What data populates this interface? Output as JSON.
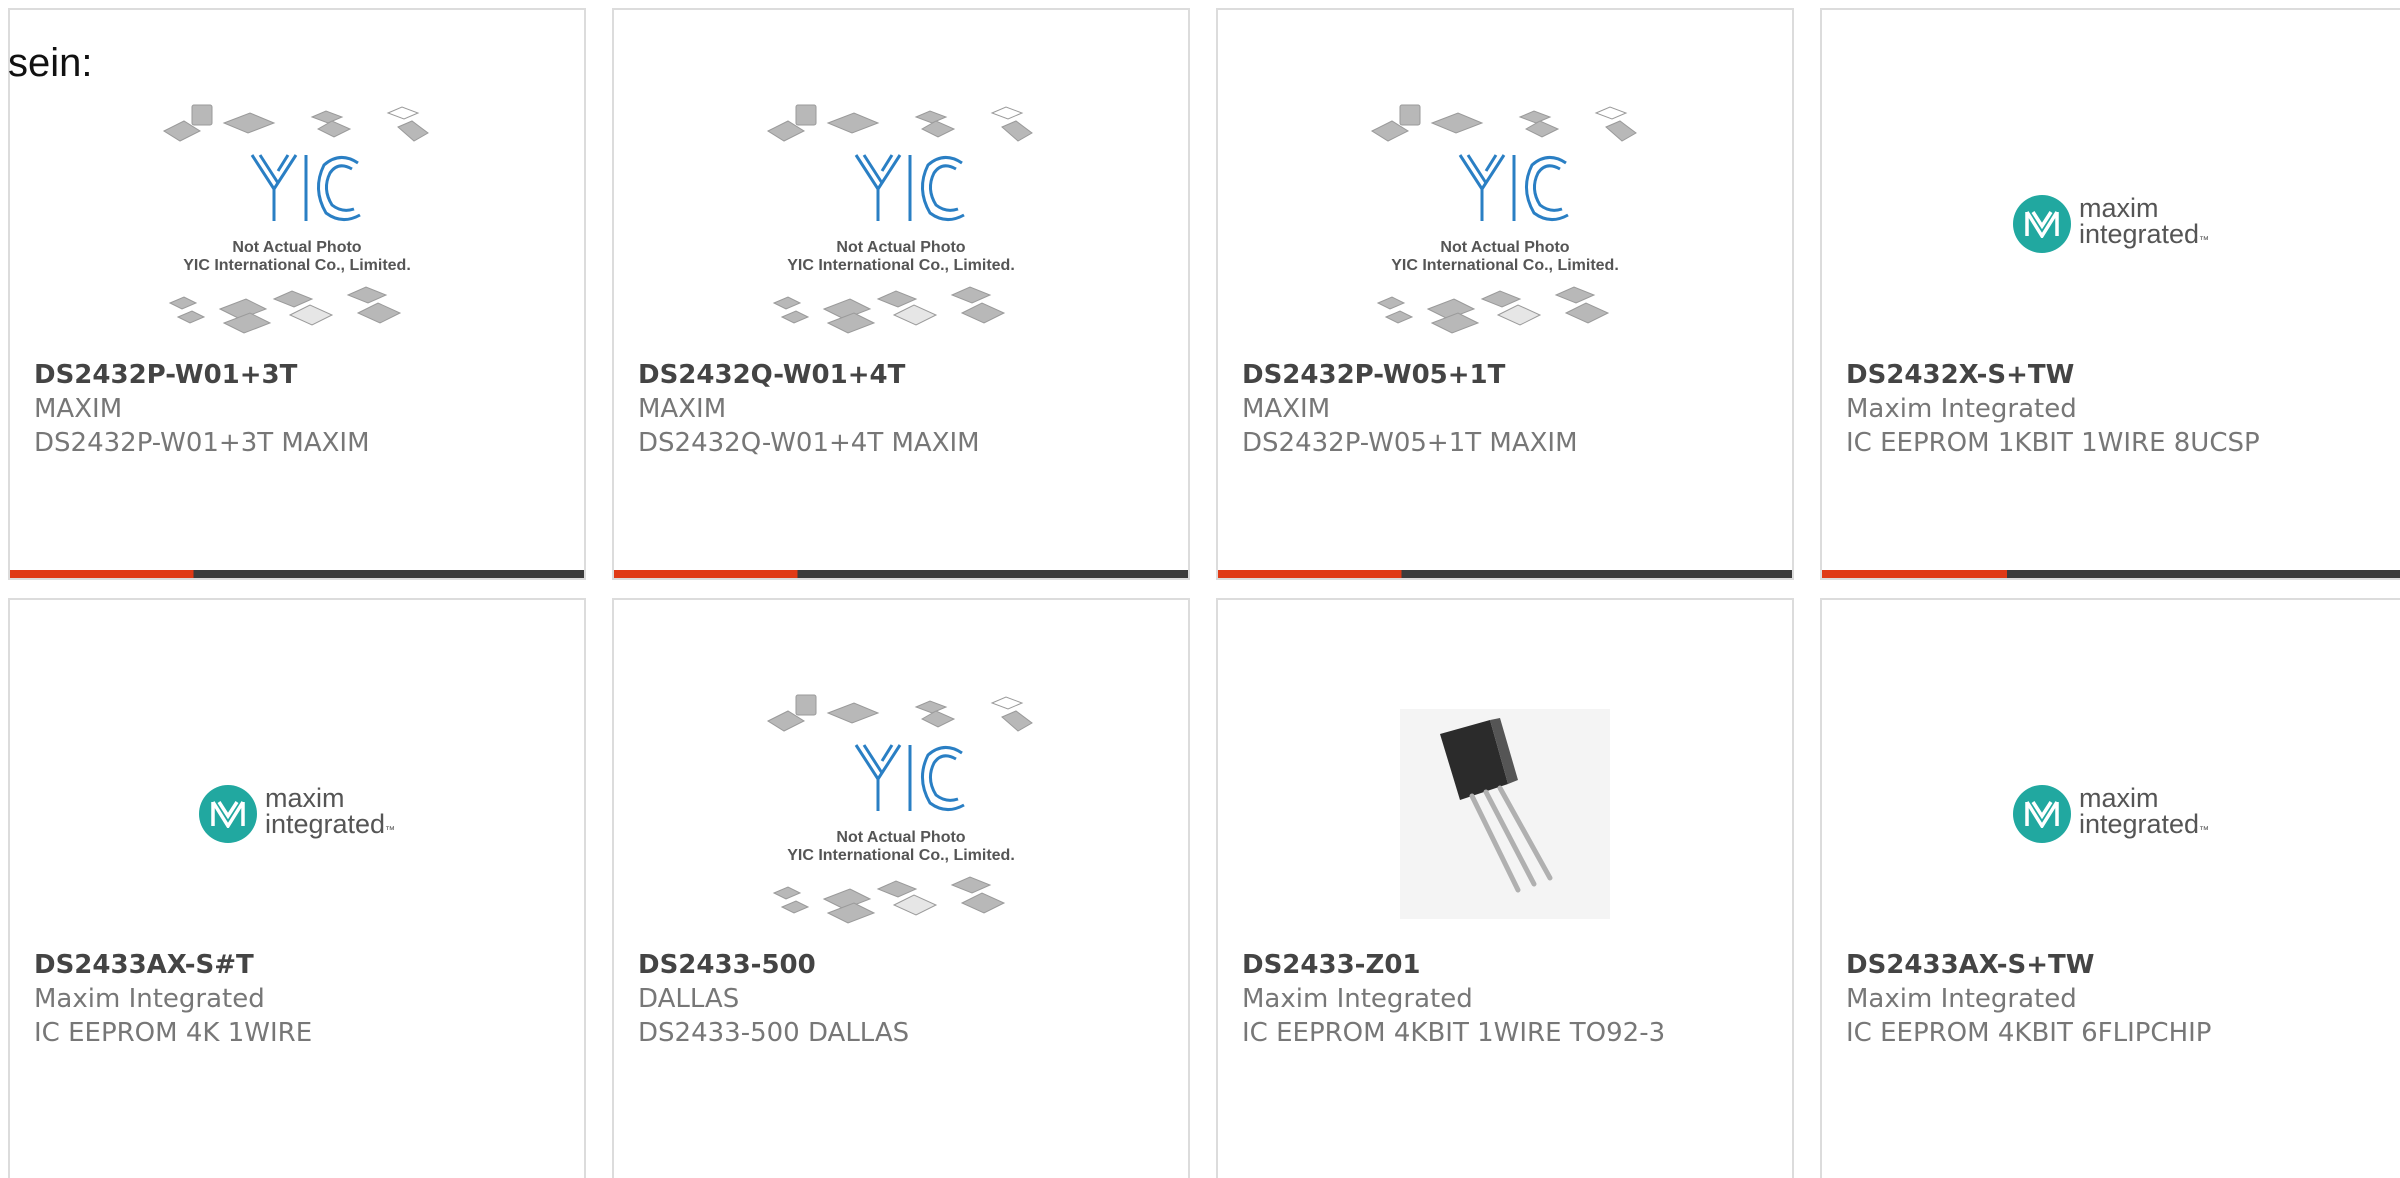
{
  "intro": "sein:",
  "products": [
    {
      "part": "DS2432P-W01+3T",
      "manufacturer": "MAXIM",
      "description": "DS2432P-W01+3T MAXIM",
      "image": "placeholder"
    },
    {
      "part": "DS2432Q-W01+4T",
      "manufacturer": "MAXIM",
      "description": "DS2432Q-W01+4T MAXIM",
      "image": "placeholder"
    },
    {
      "part": "DS2432P-W05+1T",
      "manufacturer": "MAXIM",
      "description": "DS2432P-W05+1T MAXIM",
      "image": "placeholder"
    },
    {
      "part": "DS2432X-S+TW",
      "manufacturer": "Maxim Integrated",
      "description": "IC EEPROM 1KBIT 1WIRE 8UCSP",
      "image": "maxim-logo"
    },
    {
      "part": "DS2433AX-S#T",
      "manufacturer": "Maxim Integrated",
      "description": "IC EEPROM 4K 1WIRE",
      "image": "maxim-logo"
    },
    {
      "part": "DS2433-500",
      "manufacturer": "DALLAS",
      "description": "DS2433-500 DALLAS",
      "image": "placeholder"
    },
    {
      "part": "DS2433-Z01",
      "manufacturer": "Maxim Integrated",
      "description": "IC EEPROM 4KBIT 1WIRE TO92-3",
      "image": "to92-photo"
    },
    {
      "part": "DS2433AX-S+TW",
      "manufacturer": "Maxim Integrated",
      "description": "IC EEPROM 4KBIT 6FLIPCHIP",
      "image": "maxim-logo"
    }
  ],
  "placeholder_caption": {
    "line1": "Not Actual Photo",
    "line2": "YIC International Co., Limited."
  },
  "maxim_logo": {
    "line1": "maxim",
    "line2": "integrated",
    "tm": "™"
  },
  "colors": {
    "accent": "#e03a16",
    "bar_dark": "#3c3c3c",
    "maxim_teal": "#21a8a0"
  }
}
